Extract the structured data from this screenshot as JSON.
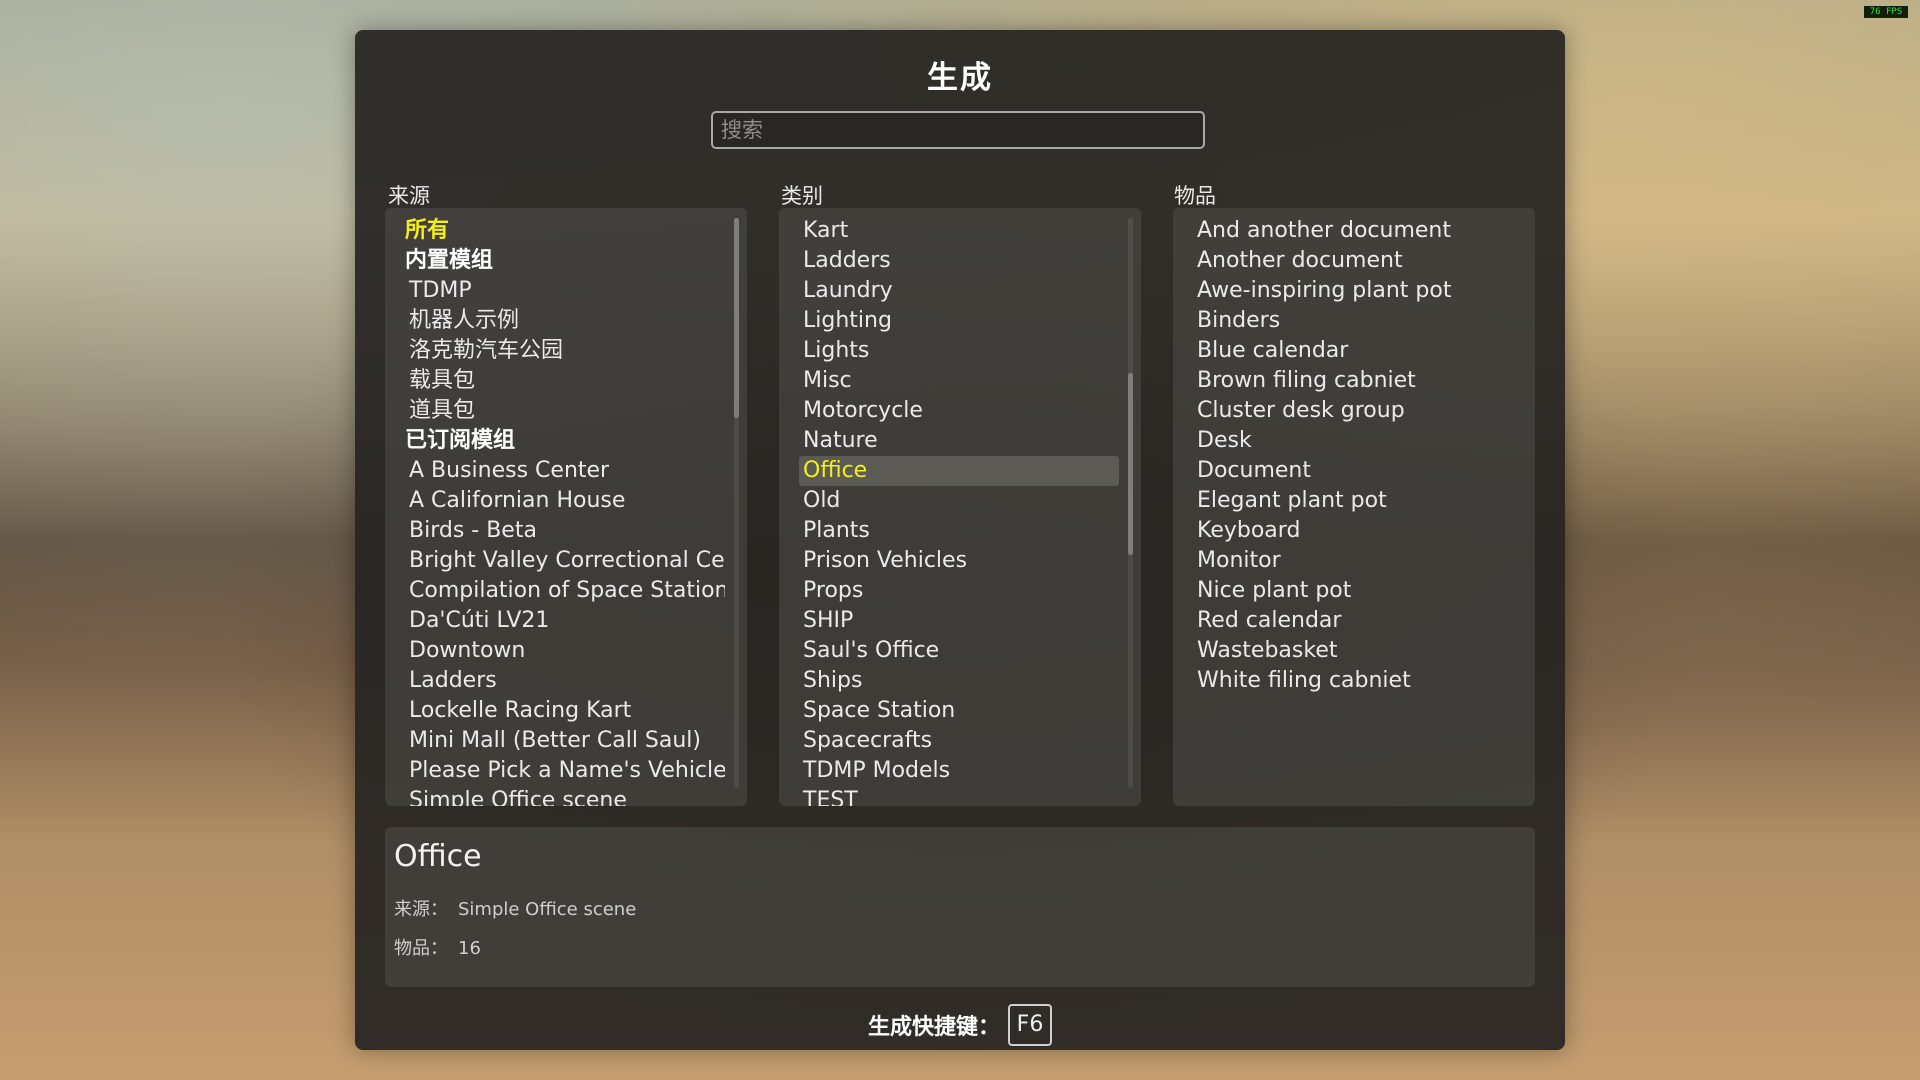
{
  "fps_label": "76 FPS",
  "title": "生成",
  "search": {
    "placeholder": "搜索",
    "value": ""
  },
  "columns": {
    "source": {
      "header": "来源",
      "items": [
        {
          "label": "所有",
          "type": "header",
          "selected": true
        },
        {
          "label": "内置模组",
          "type": "header"
        },
        {
          "label": "TDMP"
        },
        {
          "label": "机器人示例"
        },
        {
          "label": "洛克勒汽车公园"
        },
        {
          "label": "载具包"
        },
        {
          "label": "道具包"
        },
        {
          "label": "已订阅模组",
          "type": "header"
        },
        {
          "label": "A Business Center"
        },
        {
          "label": "A Californian House"
        },
        {
          "label": "Birds - Beta"
        },
        {
          "label": "Bright Valley Correctional Cente"
        },
        {
          "label": "Compilation of Space Stations"
        },
        {
          "label": "Da'Cúti LV21"
        },
        {
          "label": "Downtown"
        },
        {
          "label": "Ladders"
        },
        {
          "label": "Lockelle Racing Kart"
        },
        {
          "label": "Mini Mall (Better Call Saul)"
        },
        {
          "label": "Please Pick a Name's Vehicle Pa"
        },
        {
          "label": "Simple Office scene"
        }
      ],
      "scroll_position": 0.0,
      "scroll_visible_fraction": 0.35
    },
    "category": {
      "header": "类别",
      "items": [
        {
          "label": "Kart"
        },
        {
          "label": "Ladders"
        },
        {
          "label": "Laundry"
        },
        {
          "label": "Lighting"
        },
        {
          "label": "Lights"
        },
        {
          "label": "Misc"
        },
        {
          "label": "Motorcycle"
        },
        {
          "label": "Nature"
        },
        {
          "label": "Office",
          "selected": true
        },
        {
          "label": "Old"
        },
        {
          "label": "Plants"
        },
        {
          "label": "Prison Vehicles"
        },
        {
          "label": "Props"
        },
        {
          "label": "SHIP"
        },
        {
          "label": "Saul's Office"
        },
        {
          "label": "Ships"
        },
        {
          "label": "Space Station"
        },
        {
          "label": "Spacecrafts"
        },
        {
          "label": "TDMP Models"
        },
        {
          "label": "TEST"
        }
      ],
      "scroll_position": 0.4,
      "scroll_visible_fraction": 0.32
    },
    "items": {
      "header": "物品",
      "items": [
        {
          "label": "And another document"
        },
        {
          "label": "Another document"
        },
        {
          "label": "Awe-inspiring plant pot"
        },
        {
          "label": "Binders"
        },
        {
          "label": "Blue calendar"
        },
        {
          "label": "Brown filing cabniet"
        },
        {
          "label": "Cluster desk group"
        },
        {
          "label": "Desk"
        },
        {
          "label": "Document"
        },
        {
          "label": "Elegant plant pot"
        },
        {
          "label": "Keyboard"
        },
        {
          "label": "Monitor"
        },
        {
          "label": "Nice plant pot"
        },
        {
          "label": "Red calendar"
        },
        {
          "label": "Wastebasket"
        },
        {
          "label": "White filing cabniet"
        }
      ]
    }
  },
  "detail": {
    "title": "Office",
    "source_label": "来源：",
    "source_value": "Simple Office scene",
    "count_label": "物品：",
    "count_value": "16"
  },
  "hotkey": {
    "label": "生成快捷键：",
    "key": "F6"
  },
  "colors": {
    "selected_text": "#f3ef1a",
    "panel_bg": "#262421",
    "list_bg": "#504e4a"
  }
}
